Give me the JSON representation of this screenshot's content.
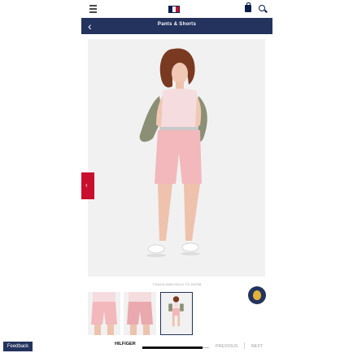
{
  "header": {
    "logo_colors": [
      "#0b1e4b",
      "#ffffff",
      "#c8102e"
    ]
  },
  "nav": {
    "title": "Pants & Shorts",
    "back_glyph": "‹"
  },
  "side_tab": {
    "glyph": "‹"
  },
  "gallery": {
    "zoom_hint": "TOUCH AND HOLD TO ZOOM",
    "selected_thumbnail": 3
  },
  "footer": {
    "feedback_label": "Feedback",
    "brand_text": "HILFIGER",
    "progress_fraction": 0.9,
    "prev_label": "PREVIOUS",
    "next_label": "NEXT"
  },
  "colors": {
    "navy": "#24335e",
    "brand_red": "#c8102e",
    "shorts_pink": "#f2b8bc",
    "top_pink": "#f5dcde",
    "jacket_olive": "#8a8f75"
  }
}
